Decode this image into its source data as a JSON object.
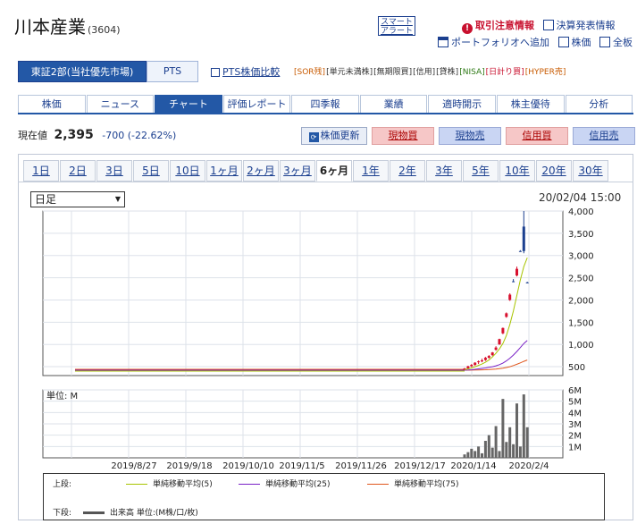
{
  "header": {
    "company": "川本産業",
    "code": "(3604)",
    "smart_alert": "スマート\nアラート",
    "links": {
      "warning": "取引注意情報",
      "earnings": "決算発表情報",
      "portfolio": "ポートフォリオへ追加",
      "stock_price": "株価",
      "full_board": "全板"
    }
  },
  "market": {
    "primary_tab": "東証2部(当社優先市場)",
    "pts_tab": "PTS",
    "pts_compare": "PTS株価比較",
    "tags": [
      "[SOR残]",
      "[単元未満株]",
      "[無期限買]",
      "[信用]",
      "[貸株]",
      "[NISA]",
      "[日計り買]",
      "[HYPER売]"
    ]
  },
  "nav": {
    "tabs": [
      "株価",
      "ニュース",
      "チャート",
      "評価レポート",
      "四季報",
      "業績",
      "適時開示",
      "株主優待",
      "分析"
    ],
    "active_index": 2
  },
  "quote": {
    "label": "現在値",
    "price": "2,395",
    "change": "-700 (-22.62%)"
  },
  "actions": {
    "refresh": "株価更新",
    "cash_buy": "現物買",
    "cash_sell": "現物売",
    "margin_buy": "信用買",
    "margin_sell": "信用売"
  },
  "periods": {
    "items": [
      "1日",
      "2日",
      "3日",
      "5日",
      "10日",
      "1ヶ月",
      "2ヶ月",
      "3ヶ月",
      "6ヶ月",
      "1年",
      "2年",
      "3年",
      "5年",
      "10年",
      "20年",
      "30年"
    ],
    "active_index": 8
  },
  "chart_controls": {
    "interval": "日足",
    "timestamp": "20/02/04 15:00"
  },
  "chart_data": {
    "type": "candlestick",
    "price_axis": {
      "ticks": [
        500,
        1000,
        1500,
        2000,
        2500,
        3000,
        3500,
        4000
      ],
      "tick_labels": [
        "500",
        "1,000",
        "1,500",
        "2,000",
        "2,500",
        "3,000",
        "3,500",
        "4,000"
      ],
      "ylim": [
        300,
        4000
      ]
    },
    "volume_axis": {
      "unit_label": "単位: M",
      "ticks": [
        1,
        2,
        3,
        4,
        5,
        6
      ],
      "tick_labels": [
        "1M",
        "2M",
        "3M",
        "4M",
        "5M",
        "6M"
      ],
      "ylim": [
        0,
        6
      ]
    },
    "x_tick_labels": [
      "2019/8/27",
      "2019/9/18",
      "2019/10/10",
      "2019/11/5",
      "2019/11/26",
      "2019/12/17",
      "2020/1/14",
      "2020/2/4"
    ],
    "grid": true,
    "baseline": 420,
    "recent_candles": [
      {
        "o": 430,
        "h": 470,
        "l": 420,
        "c": 460,
        "up": true
      },
      {
        "o": 460,
        "h": 520,
        "l": 450,
        "c": 510,
        "up": true
      },
      {
        "o": 510,
        "h": 560,
        "l": 490,
        "c": 540,
        "up": true
      },
      {
        "o": 540,
        "h": 600,
        "l": 520,
        "c": 590,
        "up": true
      },
      {
        "o": 600,
        "h": 640,
        "l": 560,
        "c": 620,
        "up": true
      },
      {
        "o": 620,
        "h": 680,
        "l": 600,
        "c": 640,
        "up": true
      },
      {
        "o": 650,
        "h": 720,
        "l": 630,
        "c": 700,
        "up": true
      },
      {
        "o": 700,
        "h": 760,
        "l": 680,
        "c": 740,
        "up": true
      },
      {
        "o": 760,
        "h": 830,
        "l": 740,
        "c": 820,
        "up": true
      },
      {
        "o": 880,
        "h": 960,
        "l": 860,
        "c": 930,
        "up": true
      },
      {
        "o": 1000,
        "h": 1130,
        "l": 990,
        "c": 1120,
        "up": true
      },
      {
        "o": 1250,
        "h": 1380,
        "l": 1230,
        "c": 1370,
        "up": true
      },
      {
        "o": 1620,
        "h": 1720,
        "l": 1600,
        "c": 1700,
        "up": true
      },
      {
        "o": 2000,
        "h": 2150,
        "l": 1980,
        "c": 2120,
        "up": true
      },
      {
        "o": 2420,
        "h": 2470,
        "l": 2400,
        "c": 2420,
        "up": false
      },
      {
        "o": 2550,
        "h": 2750,
        "l": 2530,
        "c": 2700,
        "up": true
      },
      {
        "o": 3100,
        "h": 3120,
        "l": 3090,
        "c": 3100,
        "up": false
      },
      {
        "o": 3650,
        "h": 4000,
        "l": 3050,
        "c": 3100,
        "up": false
      },
      {
        "o": 2395,
        "h": 2410,
        "l": 2380,
        "c": 2395,
        "up": false
      }
    ],
    "recent_volume": [
      0.3,
      0.5,
      0.8,
      0.6,
      1.0,
      0.4,
      1.5,
      2.0,
      0.9,
      2.8,
      0.6,
      5.2,
      1.4,
      2.7,
      1.2,
      4.8,
      1.0,
      5.6,
      2.7
    ],
    "series": [
      {
        "name": "単純移動平均(5)",
        "color": "#a8c400"
      },
      {
        "name": "単純移動平均(25)",
        "color": "#7a22c6"
      },
      {
        "name": "単純移動平均(75)",
        "color": "#e0571e"
      }
    ],
    "volume_series": {
      "name": "出来高 単位:(M株/口/枚)",
      "color": "#555555"
    }
  },
  "legend": {
    "upper_label": "上段:",
    "lower_label": "下段:"
  }
}
